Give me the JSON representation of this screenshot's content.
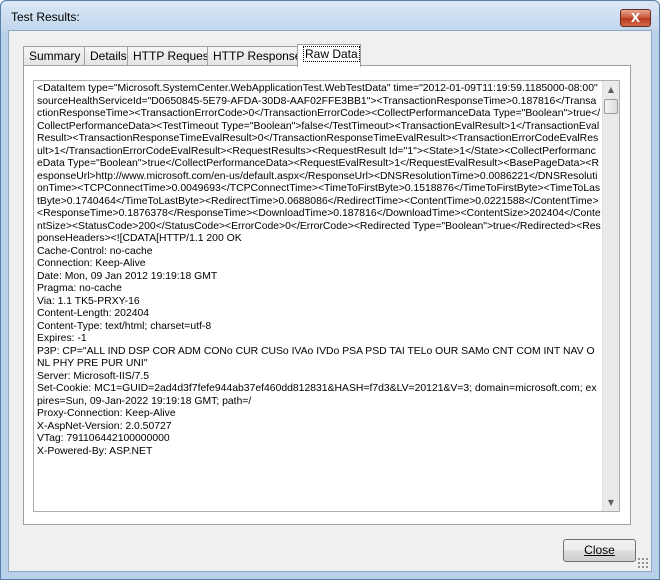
{
  "window": {
    "title": "Test Results:",
    "close_glyph": "X"
  },
  "tabs": [
    {
      "label": "Summary"
    },
    {
      "label": "Details"
    },
    {
      "label": "HTTP Request"
    },
    {
      "label": "HTTP Response"
    },
    {
      "label": "Raw Data",
      "active": true
    }
  ],
  "raw_data": {
    "text": "<DataItem type=\"Microsoft.SystemCenter.WebApplicationTest.WebTestData\" time=\"2012-01-09T11:19:59.1185000-08:00\" sourceHealthServiceId=\"D0650845-5E79-AFDA-30D8-AAF02FFE3BB1\"><TransactionResponseTime>0.187816</TransactionResponseTime><TransactionErrorCode>0</TransactionErrorCode><CollectPerformanceData Type=\"Boolean\">true</CollectPerformanceData><TestTimeout Type=\"Boolean\">false</TestTimeout><TransactionEvalResult>1</TransactionEvalResult><TransactionResponseTimeEvalResult>0</TransactionResponseTimeEvalResult><TransactionErrorCodeEvalResult>1</TransactionErrorCodeEvalResult><RequestResults><RequestResult Id=\"1\"><State>1</State><CollectPerformanceData Type=\"Boolean\">true</CollectPerformanceData><RequestEvalResult>1</RequestEvalResult><BasePageData><ResponseUrl>http://www.microsoft.com/en-us/default.aspx</ResponseUrl><DNSResolutionTime>0.0086221</DNSResolutionTime><TCPConnectTime>0.0049693</TCPConnectTime><TimeToFirstByte>0.1518876</TimeToFirstByte><TimeToLastByte>0.1740464</TimeToLastByte><RedirectTime>0.0688086</RedirectTime><ContentTime>0.0221588</ContentTime><ResponseTime>0.1876378</ResponseTime><DownloadTime>0.187816</DownloadTime><ContentSize>202404</ContentSize><StatusCode>200</StatusCode><ErrorCode>0</ErrorCode><Redirected Type=\"Boolean\">true</Redirected><ResponseHeaders><![CDATA[HTTP/1.1 200 OK\nCache-Control: no-cache\nConnection: Keep-Alive\nDate: Mon, 09 Jan 2012 19:19:18 GMT\nPragma: no-cache\nVia: 1.1 TK5-PRXY-16\nContent-Length: 202404\nContent-Type: text/html; charset=utf-8\nExpires: -1\nP3P: CP=\"ALL IND DSP COR ADM CONo CUR CUSo IVAo IVDo PSA PSD TAI TELo OUR SAMo CNT COM INT NAV ONL PHY PRE PUR UNI\"\nServer: Microsoft-IIS/7.5\nSet-Cookie: MC1=GUID=2ad4d3f7fefe944ab37ef460dd812831&HASH=f7d3&LV=20121&V=3; domain=microsoft.com; expires=Sun, 09-Jan-2022 19:19:18 GMT; path=/\nProxy-Connection: Keep-Alive\nX-AspNet-Version: 2.0.50727\nVTag: 791106442100000000\nX-Powered-By: ASP.NET"
  },
  "scrollbar": {
    "up_glyph": "▲",
    "down_glyph": "▼"
  },
  "footer": {
    "close_label": "Close"
  }
}
